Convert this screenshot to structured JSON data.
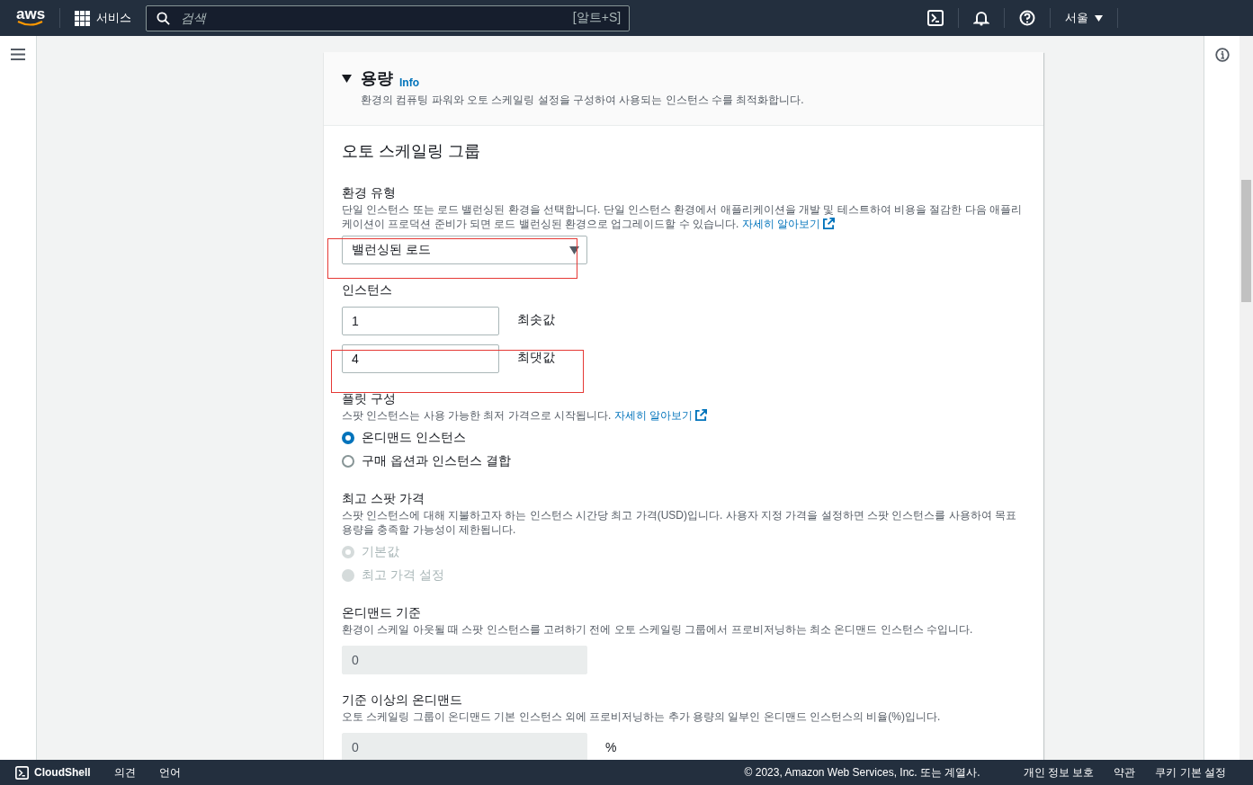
{
  "nav": {
    "logo": "aws",
    "services": "서비스",
    "search_placeholder": "검색",
    "search_shortcut": "[알트+S]",
    "region": "서울"
  },
  "section": {
    "title": "용량",
    "info": "Info",
    "description": "환경의 컴퓨팅 파워와 오토 스케일링 설정을 구성하여 사용되는 인스턴스 수를 최적화합니다.",
    "expanded": true
  },
  "group_title": "오토 스케일링 그룹",
  "fields": [
    {
      "kind": "select",
      "label": "환경 유형",
      "description": "단일 인스턴스 또는 로드 밸런싱된 환경을 선택합니다. 단일 인스턴스 환경에서 애플리케이션을 개발 및 테스트하여 비용을 절감한 다음 애플리케이션이 프로덕션 준비가 되면 로드 밸런싱된 환경으로 업그레이드할 수 있습니다.",
      "link": "자세히 알아보기",
      "value": "밸런싱된 로드",
      "highlighted": true
    },
    {
      "kind": "instances",
      "label": "인스턴스",
      "inputs": [
        {
          "value": "1",
          "suffix": "최솟값",
          "highlighted": false
        },
        {
          "value": "4",
          "suffix": "최댓값",
          "highlighted": true
        }
      ]
    },
    {
      "kind": "radio",
      "label": "플릿 구성",
      "description": "스팟 인스턴스는 사용 가능한 최저 가격으로 시작됩니다.",
      "link": "자세히 알아보기",
      "options": [
        {
          "label": "온디맨드 인스턴스",
          "selected": true,
          "disabled": false
        },
        {
          "label": "구매 옵션과 인스턴스 결합",
          "selected": false,
          "disabled": false
        }
      ]
    },
    {
      "kind": "radio",
      "label": "최고 스팟 가격",
      "description": "스팟 인스턴스에 대해 지불하고자 하는 인스턴스 시간당 최고 가격(USD)입니다. 사용자 지정 가격을 설정하면 스팟 인스턴스를 사용하여 목표 용량을 충족할 가능성이 제한됩니다.",
      "options": [
        {
          "label": "기본값",
          "selected": true,
          "disabled": true
        },
        {
          "label": "최고 가격 설정",
          "selected": false,
          "disabled": true
        }
      ]
    },
    {
      "kind": "number",
      "label": "온디맨드 기준",
      "description": "환경이 스케일 아웃될 때 스팟 인스턴스를 고려하기 전에 오토 스케일링 그룹에서 프로비저닝하는 최소 온디맨드 인스턴스 수입니다.",
      "value": "0",
      "disabled": true
    },
    {
      "kind": "number",
      "label": "기준 이상의 온디맨드",
      "description": "오토 스케일링 그룹이 온디맨드 기본 인스턴스 외에 프로비저닝하는 추가 용량의 일부인 온디맨드 인스턴스의 비율(%)입니다.",
      "value": "0",
      "suffix": "%",
      "disabled": true
    }
  ],
  "footer": {
    "cloudshell": "CloudShell",
    "left_links": [
      "의견",
      "언어"
    ],
    "copyright": "© 2023, Amazon Web Services, Inc. 또는 계열사.",
    "right_links": [
      "개인 정보 보호",
      "약관",
      "쿠키 기본 설정"
    ]
  }
}
